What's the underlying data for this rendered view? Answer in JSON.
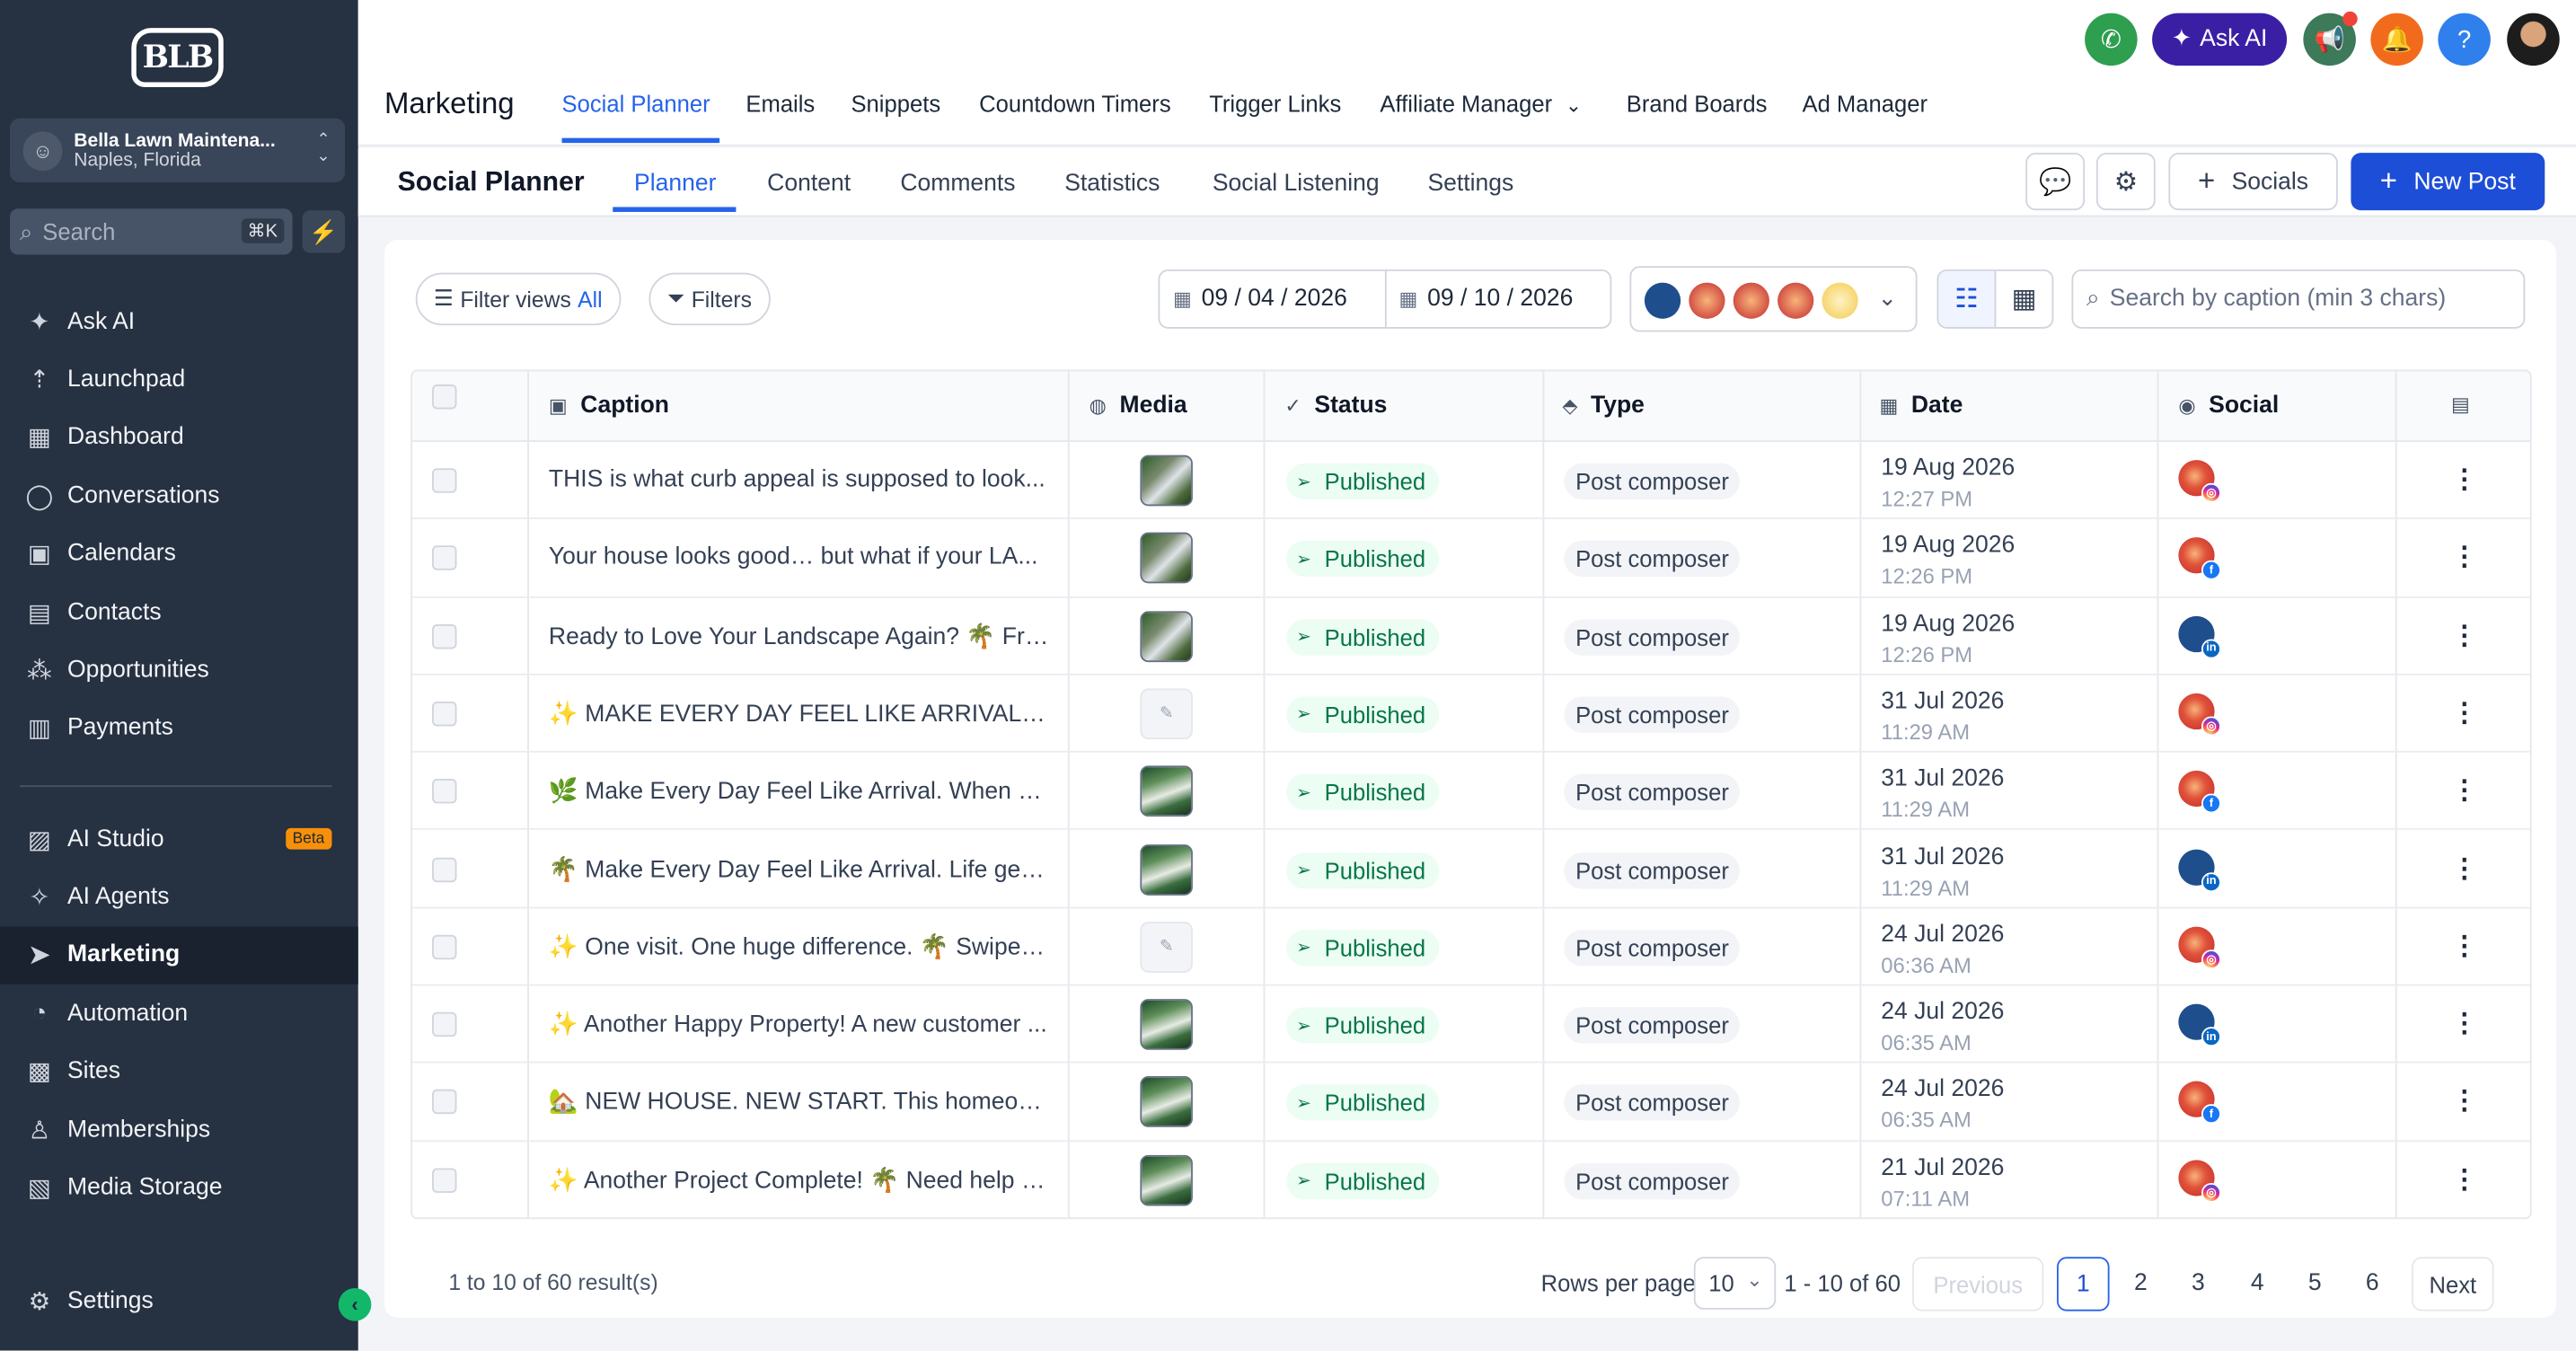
{
  "sidebar": {
    "account_name": "Bella Lawn Maintena...",
    "account_location": "Naples, Florida",
    "search_placeholder": "Search",
    "search_shortcut": "⌘K",
    "items": [
      {
        "label": "Ask AI",
        "icon": "sparkle-icon"
      },
      {
        "label": "Launchpad",
        "icon": "rocket-icon"
      },
      {
        "label": "Dashboard",
        "icon": "grid-icon"
      },
      {
        "label": "Conversations",
        "icon": "chat-icon"
      },
      {
        "label": "Calendars",
        "icon": "calendar-icon"
      },
      {
        "label": "Contacts",
        "icon": "contacts-icon"
      },
      {
        "label": "Opportunities",
        "icon": "opportunities-icon"
      },
      {
        "label": "Payments",
        "icon": "payments-icon"
      }
    ],
    "items2": [
      {
        "label": "AI Studio",
        "icon": "ai-studio-icon",
        "badge": "Beta"
      },
      {
        "label": "AI Agents",
        "icon": "ai-agents-icon"
      },
      {
        "label": "Marketing",
        "icon": "send-icon",
        "active": true
      },
      {
        "label": "Automation",
        "icon": "automation-icon"
      },
      {
        "label": "Sites",
        "icon": "sites-icon"
      },
      {
        "label": "Memberships",
        "icon": "memberships-icon"
      },
      {
        "label": "Media Storage",
        "icon": "media-icon"
      }
    ],
    "settings_label": "Settings"
  },
  "topbar": {
    "title": "Marketing",
    "tabs": [
      "Social Planner",
      "Emails",
      "Snippets",
      "Countdown Timers",
      "Trigger Links",
      "Affiliate Manager",
      "Brand Boards",
      "Ad Manager"
    ],
    "active_tab": "Social Planner",
    "ask_ai_label": "Ask AI",
    "colors": {
      "phone": "#2e9e4f",
      "ask_ai": "#3a1fa5",
      "megaphone": "#3d7a5a",
      "bell": "#f26b1d",
      "help": "#2f80ed"
    }
  },
  "subbar": {
    "title": "Social Planner",
    "tabs": [
      "Planner",
      "Content",
      "Comments",
      "Statistics",
      "Social Listening",
      "Settings"
    ],
    "active_tab": "Planner",
    "socials_label": "Socials",
    "new_post_label": "New Post"
  },
  "filters": {
    "filter_views_label": "Filter views",
    "filter_views_value": "All",
    "filters_label": "Filters",
    "date_from": "09 / 04 / 2026",
    "date_to": "09 / 10 / 2026",
    "search_placeholder": "Search by caption (min 3 chars)"
  },
  "table": {
    "columns": [
      "Caption",
      "Media",
      "Status",
      "Type",
      "Date",
      "Social"
    ],
    "rows": [
      {
        "caption": "THIS is what curb appeal is supposed to look...",
        "media": "image",
        "status": "Published",
        "type": "Post composer",
        "date": "19 Aug 2026",
        "time": "12:27 PM",
        "social": "red",
        "network": "ig"
      },
      {
        "caption": "Your house looks good… but what if your LA...",
        "media": "image",
        "status": "Published",
        "type": "Post composer",
        "date": "19 Aug 2026",
        "time": "12:26 PM",
        "social": "red",
        "network": "fb"
      },
      {
        "caption": "Ready to Love Your Landscape Again? 🌴 Fro...",
        "media": "image",
        "status": "Published",
        "type": "Post composer",
        "date": "19 Aug 2026",
        "time": "12:26 PM",
        "social": "blue",
        "network": "li"
      },
      {
        "caption": "✨ MAKE EVERY DAY FEEL LIKE ARRIVAL. Lif...",
        "media": "placeholder",
        "status": "Published",
        "type": "Post composer",
        "date": "31 Jul 2026",
        "time": "11:29 AM",
        "social": "red",
        "network": "ig"
      },
      {
        "caption": "🌿 Make Every Day Feel Like Arrival. When w...",
        "media": "image2",
        "status": "Published",
        "type": "Post composer",
        "date": "31 Jul 2026",
        "time": "11:29 AM",
        "social": "red",
        "network": "fb"
      },
      {
        "caption": "🌴 Make Every Day Feel Like Arrival. Life gets...",
        "media": "image2",
        "status": "Published",
        "type": "Post composer",
        "date": "31 Jul 2026",
        "time": "11:29 AM",
        "social": "blue",
        "network": "li"
      },
      {
        "caption": "✨ One visit. One huge difference. 🌴 Swipe t...",
        "media": "placeholder",
        "status": "Published",
        "type": "Post composer",
        "date": "24 Jul 2026",
        "time": "06:36 AM",
        "social": "red",
        "network": "ig"
      },
      {
        "caption": "✨ Another Happy Property! A new customer ...",
        "media": "image2",
        "status": "Published",
        "type": "Post composer",
        "date": "24 Jul 2026",
        "time": "06:35 AM",
        "social": "blue",
        "network": "li"
      },
      {
        "caption": "🏡 NEW HOUSE. NEW START. This homeown...",
        "media": "image2",
        "status": "Published",
        "type": "Post composer",
        "date": "24 Jul 2026",
        "time": "06:35 AM",
        "social": "red",
        "network": "fb"
      },
      {
        "caption": "✨ Another Project Complete! 🌴 Need help vi...",
        "media": "image2",
        "status": "Published",
        "type": "Post composer",
        "date": "21 Jul 2026",
        "time": "07:11 AM",
        "social": "red",
        "network": "ig"
      }
    ]
  },
  "footer": {
    "results": "1 to 10 of 60 result(s)",
    "rows_per_page_label": "Rows per page",
    "rows_per_page": "10",
    "range": "1 - 10 of 60",
    "previous": "Previous",
    "pages": [
      "1",
      "2",
      "3",
      "4",
      "5",
      "6"
    ],
    "current_page": "1",
    "next": "Next"
  }
}
